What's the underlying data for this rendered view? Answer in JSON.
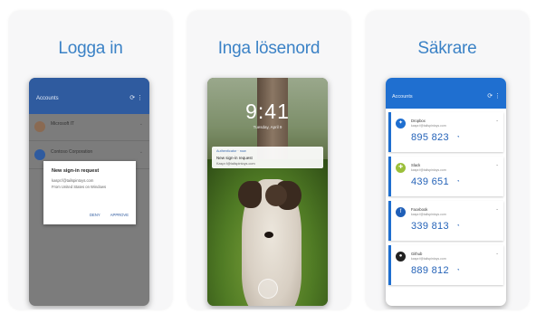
{
  "cards": [
    {
      "title": "Logga in",
      "screen": {
        "appbar_title": "Accounts",
        "appbar_icons": "⟳ ⋮",
        "rows": [
          {
            "name": "Microsoft IT",
            "chevron": "⌄"
          },
          {
            "name": "Contoso Corporation",
            "chevron": "⌄"
          }
        ],
        "dialog": {
          "title": "New sign-in request",
          "email": "kaspr.f@tailspintoys.com",
          "location": "From United States on Windows",
          "deny_label": "DENY",
          "approve_label": "APPROVE"
        }
      }
    },
    {
      "title": "Inga lösenord",
      "screen": {
        "clock": "9:41",
        "date": "Tuesday, April 9",
        "notification": {
          "app": "Authenticator · now",
          "title": "New sign-in request",
          "text": "Kaspr.f@tailspintoys.com"
        }
      }
    },
    {
      "title": "Säkrare",
      "screen": {
        "appbar_title": "Accounts",
        "appbar_icons": "⟳ ⋮",
        "accounts": [
          {
            "name": "Dropbox",
            "email": "kaspr.f@tailspintoys.com",
            "code": "895 823",
            "timer": "◔",
            "icon": "dropbox-icon",
            "icon_glyph": "✦",
            "color": "#1f6fd0"
          },
          {
            "name": "Slack",
            "email": "kaspr.f@tailspintoys.com",
            "code": "439 651",
            "timer": "◔",
            "icon": "slack-icon",
            "icon_glyph": "✚",
            "color": "#9bbf3a"
          },
          {
            "name": "Facebook",
            "email": "kaspr.f@tailspintoys.com",
            "code": "339 813",
            "timer": "◔",
            "icon": "facebook-icon",
            "icon_glyph": "f",
            "color": "#1f5fb8"
          },
          {
            "name": "Github",
            "email": "kaspr.f@tailspintoys.com",
            "code": "889 812",
            "timer": "◔",
            "icon": "github-icon",
            "icon_glyph": "●",
            "color": "#222222"
          }
        ]
      }
    }
  ]
}
